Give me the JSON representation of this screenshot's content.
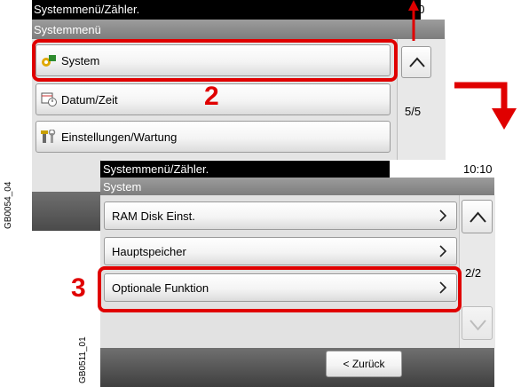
{
  "back_screen": {
    "title": "Systemmenü/Zähler.",
    "time": "10:10",
    "subtitle": "Systemmenü",
    "items": [
      {
        "label": "System",
        "icon": "system-gear-icon"
      },
      {
        "label": "Datum/Zeit",
        "icon": "calendar-clock-icon"
      },
      {
        "label": "Einstellungen/Wartung",
        "icon": "tools-icon"
      }
    ],
    "page": "5/5"
  },
  "front_screen": {
    "title": "Systemmenü/Zähler.",
    "time": "10:10",
    "subtitle": "System",
    "items": [
      {
        "label": "RAM Disk Einst."
      },
      {
        "label": "Hauptspeicher"
      },
      {
        "label": "Optionale Funktion"
      }
    ],
    "page": "2/2",
    "back_label": "< Zurück"
  },
  "steps": {
    "step2": "2",
    "step3": "3"
  },
  "image_ids": {
    "back": "GB0054_04",
    "front": "GB0511_01"
  },
  "colors": {
    "highlight": "#e00000",
    "title_bar": "#000000",
    "subtitle_bar": "#8a8a8a"
  }
}
